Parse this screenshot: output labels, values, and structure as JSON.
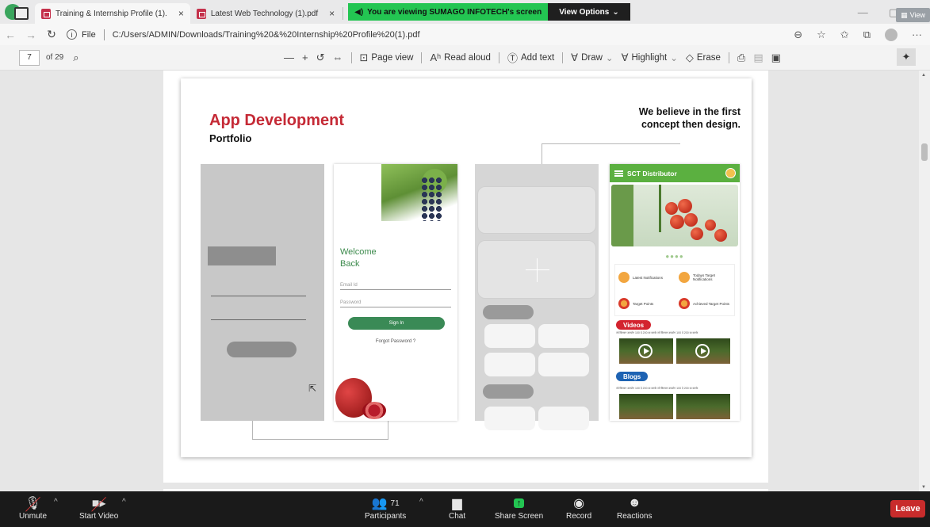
{
  "browser": {
    "tabs": [
      {
        "label": "Training & Internship Profile (1).",
        "active": true
      },
      {
        "label": "Latest Web Technology (1).pdf",
        "active": false
      }
    ],
    "share_banner": "You are viewing SUMAGO INFOTECH's screen",
    "view_options": "View Options",
    "view_button": "View",
    "address": {
      "file_label": "File",
      "url": "C:/Users/ADMIN/Downloads/Training%20&%20Internship%20Profile%20(1).pdf"
    }
  },
  "pdf_toolbar": {
    "page_number": "7",
    "page_count": "of 29",
    "page_view": "Page view",
    "read_aloud": "Read aloud",
    "add_text": "Add text",
    "draw": "Draw",
    "highlight": "Highlight",
    "erase": "Erase"
  },
  "slide": {
    "title": "App Development",
    "subtitle": "Portfolio",
    "quote": "We believe in the first concept then design.",
    "login_screen": {
      "welcome": "Welcome\nBack",
      "email_placeholder": "Email Id",
      "password_placeholder": "Password",
      "sign_in": "Sign In",
      "forgot": "Forgot Password ?"
    },
    "distributor_app": {
      "header": "SCT Distributor",
      "dots": "●●●●",
      "cards": [
        "Latest Notifications",
        "Todays Target Notifications",
        "Target Points",
        "Achieved Target Points"
      ],
      "videos_label": "Videos",
      "blogs_label": "Blogs",
      "caption": "जो किसान उपयोग 100 दे 200 ग्रा करके   जो किसान उपयोग 100 दे 200 ग्रा करके"
    }
  },
  "zoom": {
    "unmute": "Unmute",
    "start_video": "Start Video",
    "participants": "Participants",
    "participant_count": "71",
    "chat": "Chat",
    "share_screen": "Share Screen",
    "record": "Record",
    "reactions": "Reactions",
    "leave": "Leave"
  },
  "colors": {
    "title_red": "#c52a36",
    "app_green": "#5bb040",
    "share_green": "#23c552",
    "leave_red": "#c82c2c"
  }
}
